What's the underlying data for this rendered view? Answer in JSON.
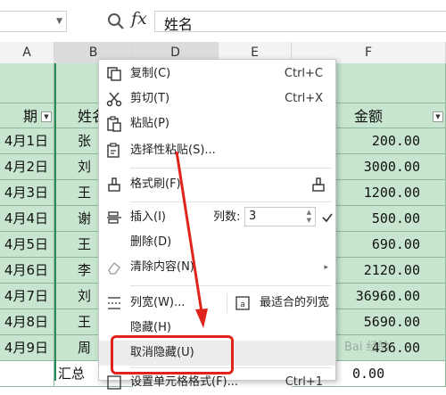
{
  "namebox": {
    "value": ""
  },
  "formula": {
    "fx_label": "fx",
    "value": "姓名"
  },
  "columns": [
    {
      "key": "A",
      "label": "A"
    },
    {
      "key": "B",
      "label": "B"
    },
    {
      "key": "D",
      "label": "D"
    },
    {
      "key": "E",
      "label": "E"
    },
    {
      "key": "F",
      "label": "F"
    }
  ],
  "table": {
    "header": {
      "date": "期",
      "name": "姓名",
      "amount": "金额"
    },
    "rows": [
      {
        "date": "4月1日",
        "name": "张",
        "amount": "200.00"
      },
      {
        "date": "4月2日",
        "name": "刘",
        "amount": "3000.00"
      },
      {
        "date": "4月3日",
        "name": "王",
        "amount": "1200.00"
      },
      {
        "date": "4月4日",
        "name": "谢",
        "amount": "500.00"
      },
      {
        "date": "4月5日",
        "name": "王",
        "amount": "690.00"
      },
      {
        "date": "4月6日",
        "name": "李",
        "amount": "2120.00"
      },
      {
        "date": "4月7日",
        "name": "刘",
        "amount": "36960.00"
      },
      {
        "date": "4月8日",
        "name": "王",
        "amount": "5690.00"
      },
      {
        "date": "4月9日",
        "name": "周",
        "amount": "436.00"
      }
    ],
    "total": {
      "label": "汇总",
      "amount": "0.00"
    }
  },
  "menu": {
    "copy": {
      "label": "复制(C)",
      "shortcut": "Ctrl+C"
    },
    "cut": {
      "label": "剪切(T)",
      "shortcut": "Ctrl+X"
    },
    "paste": {
      "label": "粘贴(P)"
    },
    "paste_special": {
      "label": "选择性粘贴(S)..."
    },
    "format_painter": {
      "label": "格式刷(F)"
    },
    "insert": {
      "label": "插入(I)",
      "count_label": "列数:",
      "count_value": "3"
    },
    "delete": {
      "label": "删除(D)"
    },
    "clear": {
      "label": "清除内容(N)"
    },
    "col_width": {
      "label": "列宽(W)...",
      "auto_label": "最适合的列宽"
    },
    "hide": {
      "label": "隐藏(H)"
    },
    "unhide": {
      "label": "取消隐藏(U)"
    },
    "format_cells": {
      "label": "设置单元格格式(F)...",
      "shortcut": "Ctrl+1"
    }
  },
  "watermark": "Bai 经验",
  "colors": {
    "green_fill": "#c8e6cf",
    "highlight": "#e0241b",
    "accent": "#2e8b57"
  }
}
